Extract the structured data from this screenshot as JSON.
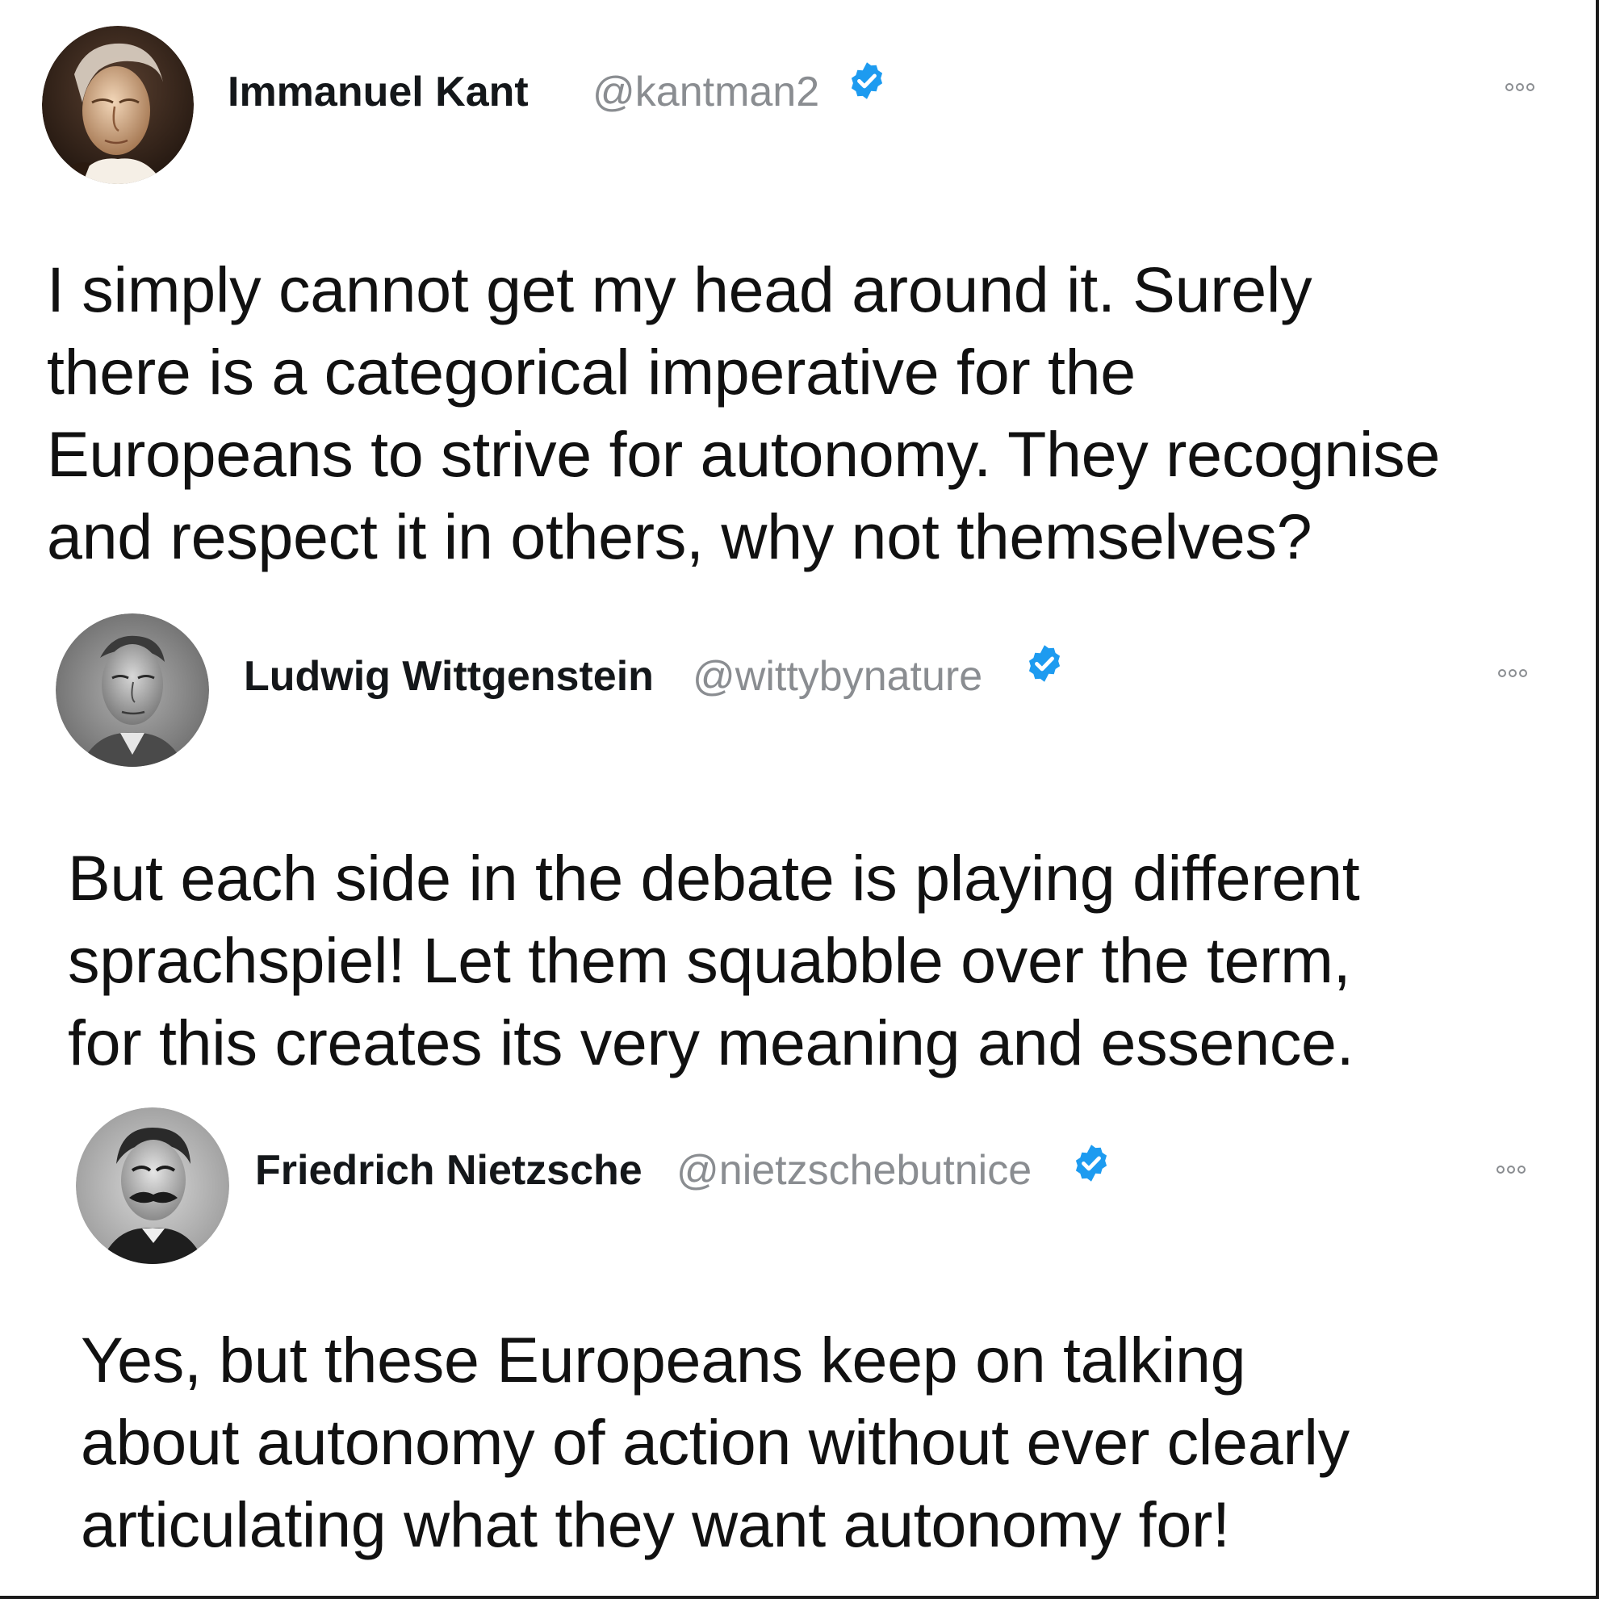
{
  "tweets": [
    {
      "name": "Immanuel Kant",
      "handle": "@kantman2",
      "verified": true,
      "avatar_icon": "portrait-kant",
      "text_lines": [
        "I simply cannot get my head around it. Surely",
        "there is a categorical imperative for the",
        "Europeans to strive for autonomy. They recognise",
        "and respect it in others, why not themselves?"
      ]
    },
    {
      "name": "Ludwig Wittgenstein",
      "handle": "@wittybynature",
      "verified": true,
      "avatar_icon": "portrait-wittgenstein",
      "text_lines": [
        "But each side in the debate is playing different",
        "sprachspiel! Let them squabble over the term,",
        "for this creates its very meaning and essence."
      ]
    },
    {
      "name": "Friedrich Nietzsche",
      "handle": "@nietzschebutnice",
      "verified": true,
      "avatar_icon": "portrait-nietzsche",
      "text_lines": [
        "Yes, but these Europeans keep on talking",
        "about autonomy of action without ever clearly",
        "articulating what they want autonomy for!"
      ]
    }
  ],
  "colors": {
    "verified_blue": "#1d9bf0",
    "handle_gray": "#8a8d91",
    "name_black": "#14171a"
  },
  "icons": {
    "verified": "verified-badge-icon",
    "more": "more-options-icon"
  }
}
